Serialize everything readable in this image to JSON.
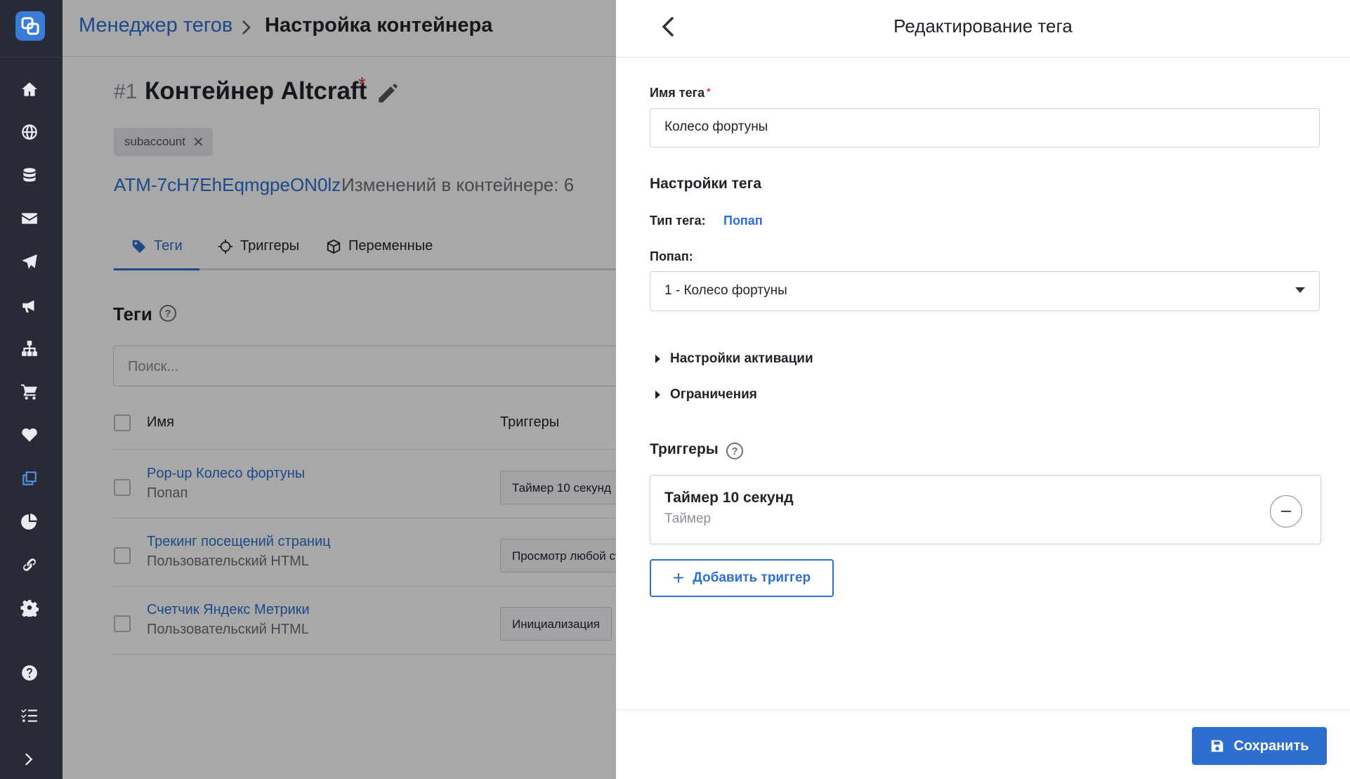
{
  "breadcrumb": {
    "parent": "Менеджер тегов",
    "current": "Настройка контейнера"
  },
  "container": {
    "number": "#1",
    "title": "Контейнер Altcraft",
    "required_mark": "*",
    "chip": "subaccount",
    "chip_close": "✕",
    "id": "ATM-7cH7EhEqmgpeON0lz",
    "changes": "Изменений в контейнере: 6"
  },
  "tabs": [
    {
      "label": "Теги",
      "icon": "tag-icon",
      "active": true
    },
    {
      "label": "Триггеры",
      "icon": "crosshair-icon",
      "active": false
    },
    {
      "label": "Переменные",
      "icon": "cube-icon",
      "active": false
    }
  ],
  "tags_section": {
    "title": "Теги",
    "help": "?",
    "search_placeholder": "Поиск...",
    "columns": {
      "name": "Имя",
      "triggers": "Триггеры"
    },
    "rows": [
      {
        "name": "Pop-up Колесо фортуны",
        "type": "Попап",
        "trigger": "Таймер 10 секунд"
      },
      {
        "name": "Трекинг посещений страниц",
        "type": "Пользовательский HTML",
        "trigger": "Просмотр любой стра"
      },
      {
        "name": "Счетчик Яндекс Метрики",
        "type": "Пользовательский HTML",
        "trigger": "Инициализация"
      }
    ]
  },
  "panel": {
    "title": "Редактирование тега",
    "tag_name_label": "Имя тега",
    "required_mark": "*",
    "tag_name_value": "Колесо фортуны",
    "settings_title": "Настройки тега",
    "tag_type_label": "Тип тега:",
    "tag_type_value": "Попап",
    "popup_label": "Попап:",
    "popup_value": "1 - Колесо фортуны",
    "activation_settings": "Настройки активации",
    "restrictions": "Ограничения",
    "triggers_title": "Триггеры",
    "help": "?",
    "trigger": {
      "name": "Таймер 10 секунд",
      "type": "Таймер"
    },
    "add_trigger": "Добавить триггер",
    "add_symbol": "+",
    "save": "Сохранить"
  },
  "sidebar_icons": [
    "home-icon",
    "globe-icon",
    "database-icon",
    "mail-icon",
    "paper-plane-icon",
    "megaphone-icon",
    "sitemap-icon",
    "cart-icon",
    "heart-icon",
    "windows-icon",
    "pie-chart-icon",
    "link-icon",
    "gear-icon",
    "help-icon",
    "checklist-icon",
    "chevron-right-icon"
  ],
  "colors": {
    "accent": "#2d6fd1",
    "sidebar_bg": "#262b36",
    "required": "#d32f2f"
  }
}
